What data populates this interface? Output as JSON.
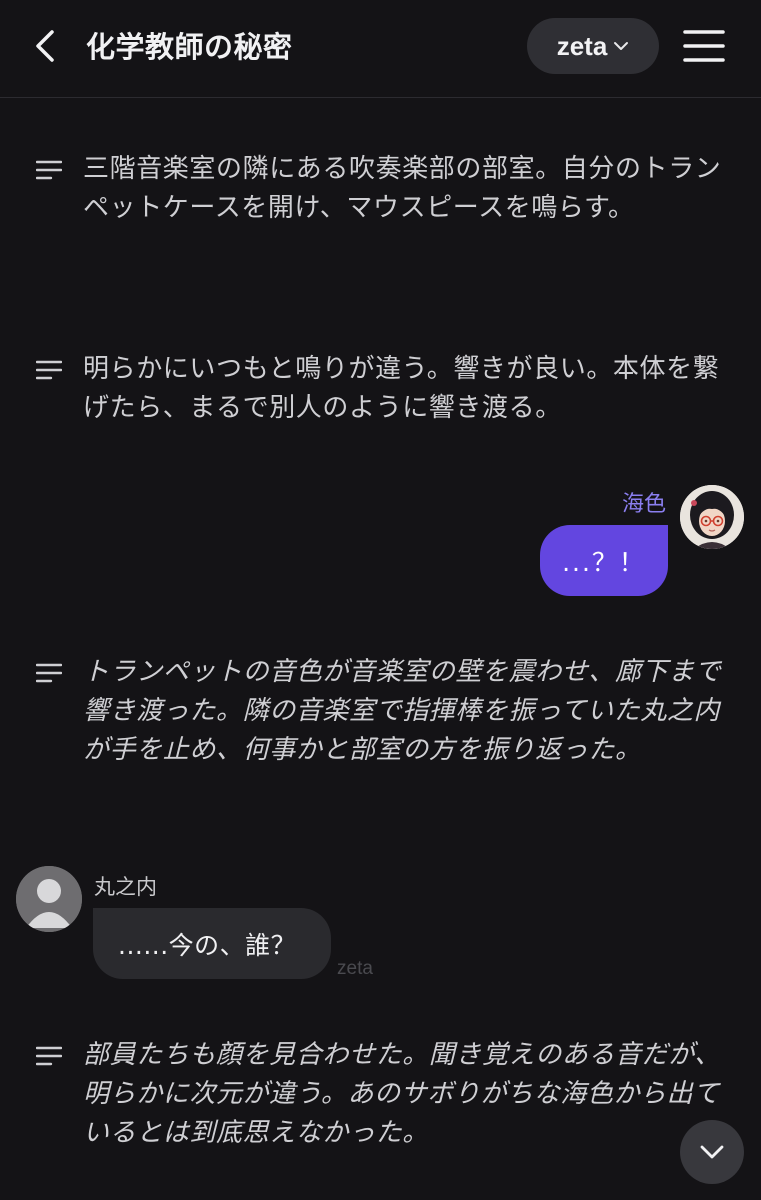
{
  "header": {
    "title": "化学教師の秘密",
    "model_label": "zeta",
    "back_icon": "chevron-left-icon",
    "menu_icon": "hamburger-menu-icon"
  },
  "messages": [
    {
      "type": "narration",
      "text": "三階音楽室の隣にある吹奏楽部の部室。自分のトランペットケースを開け、マウスピースを鳴らす。"
    },
    {
      "type": "narration",
      "text": "明らかにいつもと鳴りが違う。響きが良い。本体を繋げたら、まるで別人のように響き渡る。"
    },
    {
      "type": "user",
      "name": "海色",
      "text": "...？！"
    },
    {
      "type": "narration",
      "text": "トランペットの音色が音楽室の壁を震わせ、廊下まで響き渡った。隣の音楽室で指揮棒を振っていた丸之内が手を止め、何事かと部室の方を振り返った。"
    },
    {
      "type": "character",
      "name": "丸之内",
      "text": "......今の、誰？"
    },
    {
      "type": "narration",
      "text": "部員たちも顔を見合わせた。聞き覚えのある音だが、明らかに次元が違う。あのサボりがちな海色から出ているとは到底思えなかった。"
    }
  ],
  "watermark": "zeta",
  "colors": {
    "background": "#141316",
    "user_bubble": "#6346e0",
    "user_name": "#8b7ff0",
    "bot_bubble": "#2a2a2e"
  }
}
